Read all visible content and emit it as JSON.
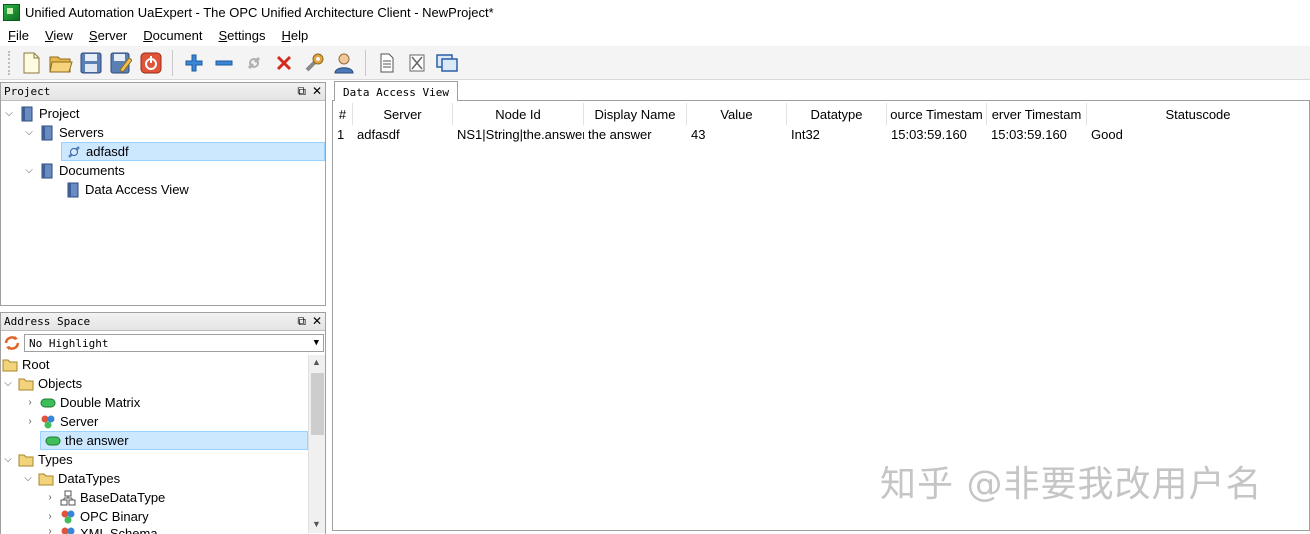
{
  "window": {
    "title": "Unified Automation UaExpert - The OPC Unified Architecture Client - NewProject*"
  },
  "menu": [
    {
      "label": "File",
      "key": "F",
      "rest": "ile"
    },
    {
      "label": "View",
      "key": "V",
      "rest": "iew"
    },
    {
      "label": "Server",
      "key": "S",
      "rest": "erver"
    },
    {
      "label": "Document",
      "key": "D",
      "rest": "ocument"
    },
    {
      "label": "Settings",
      "key": "S",
      "rest": "ettings"
    },
    {
      "label": "Help",
      "key": "H",
      "rest": "elp"
    }
  ],
  "toolbar": {
    "icons": [
      "new-project-icon",
      "open-project-icon",
      "save-project-icon",
      "save-as-icon",
      "power-icon",
      "add-server-icon",
      "remove-server-icon",
      "connect-icon",
      "disconnect-icon",
      "settings-wrench-icon",
      "user-icon",
      "document-icon",
      "delete-document-icon",
      "window-icon"
    ]
  },
  "project_panel": {
    "title": "Project",
    "items": {
      "project": "Project",
      "servers": "Servers",
      "server": "adfasdf",
      "documents": "Documents",
      "document": "Data Access View"
    }
  },
  "address_panel": {
    "title": "Address Space",
    "highlight": "No Highlight",
    "items": {
      "root": "Root",
      "objects": "Objects",
      "double_matrix": "Double Matrix",
      "server": "Server",
      "the_answer": "the answer",
      "types": "Types",
      "datatypes": "DataTypes",
      "base_datatype": "BaseDataType",
      "opc_binary": "OPC Binary",
      "xml_schema": "XML Schema"
    }
  },
  "watermark": "知乎 @非要我改用户名",
  "data_view": {
    "tab": "Data Access View",
    "columns": [
      "#",
      "Server",
      "Node Id",
      "Display Name",
      "Value",
      "Datatype",
      "ource Timestam",
      "erver Timestam",
      "Statuscode"
    ],
    "rows": [
      [
        "1",
        "adfasdf",
        "NS1|String|the.answer",
        "the answer",
        "43",
        "Int32",
        "15:03:59.160",
        "15:03:59.160",
        "Good"
      ]
    ]
  }
}
